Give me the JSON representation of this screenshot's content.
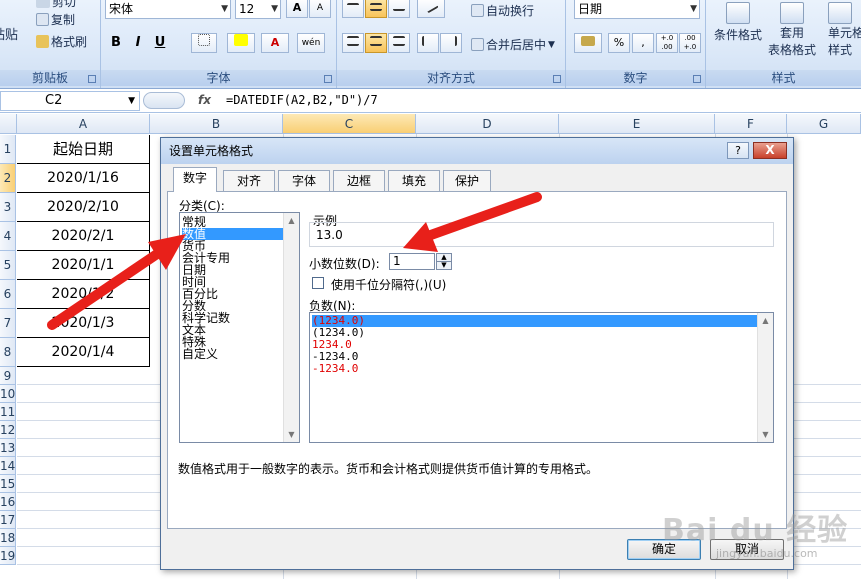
{
  "ribbon": {
    "clipboard": {
      "paste": "贴贴",
      "cut": "剪切",
      "copy": "复制",
      "format_painter": "格式刷",
      "label": "剪贴板"
    },
    "font": {
      "name": "宋体",
      "size": "12",
      "bold": "B",
      "italic": "I",
      "underline": "U",
      "grow": "A",
      "shrink": "A",
      "phonetic": "wén",
      "label": "字体"
    },
    "alignment": {
      "wrap": "自动换行",
      "merge": "合并后居中",
      "label": "对齐方式"
    },
    "number": {
      "format": "日期",
      "currency": "%",
      "comma": ",",
      "inc": "+.0 .00",
      "dec": ".00 +.0",
      "label": "数字"
    },
    "styles": {
      "conditional": "条件格式",
      "table_line1": "套用",
      "table_line2": "表格格式",
      "cell_line1": "单元格",
      "cell_line2": "样式",
      "label": "样式"
    }
  },
  "formula_bar": {
    "name_box": "C2",
    "fx": "fx",
    "formula": "=DATEDIF(A2,B2,\"D\")/7"
  },
  "grid": {
    "columns": [
      "A",
      "B",
      "C",
      "D",
      "E",
      "F",
      "G"
    ],
    "rows": [
      "1",
      "2",
      "3",
      "4",
      "5",
      "6",
      "7",
      "8",
      "9",
      "10",
      "11",
      "12",
      "13",
      "14",
      "15",
      "16",
      "17",
      "18",
      "19"
    ],
    "col_a_cells": [
      "起始日期",
      "2020/1/16",
      "2020/2/10",
      "2020/2/1",
      "2020/1/1",
      "2020/1/2",
      "2020/1/3",
      "2020/1/4"
    ]
  },
  "dialog": {
    "title": "设置单元格格式",
    "help": "?",
    "close": "X",
    "tabs": [
      "数字",
      "对齐",
      "字体",
      "边框",
      "填充",
      "保护"
    ],
    "category_label": "分类(C):",
    "categories": [
      "常规",
      "数值",
      "货币",
      "会计专用",
      "日期",
      "时间",
      "百分比",
      "分数",
      "科学记数",
      "文本",
      "特殊",
      "自定义"
    ],
    "sample_label": "示例",
    "sample_value": "13.0",
    "decimal_label": "小数位数(D):",
    "decimal_value": "1",
    "thousands_label": "使用千位分隔符(,)(U)",
    "negative_label": "负数(N):",
    "negative_formats": [
      "(1234.0)",
      "(1234.0)",
      "1234.0",
      "-1234.0",
      "-1234.0"
    ],
    "description": "数值格式用于一般数字的表示。货币和会计格式则提供货币值计算的专用格式。",
    "ok": "确定",
    "cancel": "取消"
  },
  "colors": {
    "accent_select": "#3399ff",
    "negative_red": "#e00000",
    "arrow_red": "#e8201a"
  },
  "watermark": {
    "main": "Bai du 经验",
    "sub": "jingyan.baidu.com"
  }
}
